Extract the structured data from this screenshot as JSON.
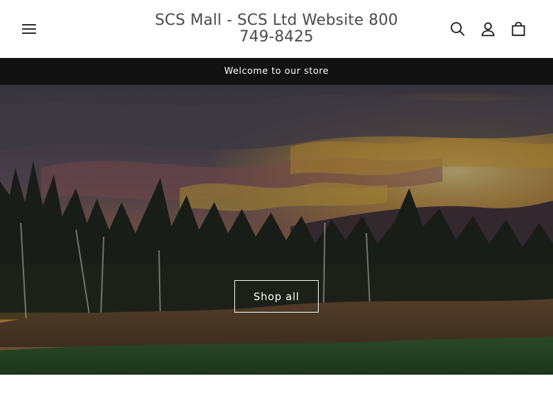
{
  "header": {
    "site_title": "SCS Mall - SCS Ltd Website 800 749-8425",
    "icons": [
      "menu-icon",
      "search-icon",
      "account-icon",
      "cart-icon"
    ]
  },
  "announcement": {
    "text": "Welcome to our store"
  },
  "hero": {
    "button_label": "Shop all"
  },
  "colors": {
    "announcement_bg": "#121212",
    "text_muted": "#4a4a4a",
    "white": "#ffffff"
  }
}
